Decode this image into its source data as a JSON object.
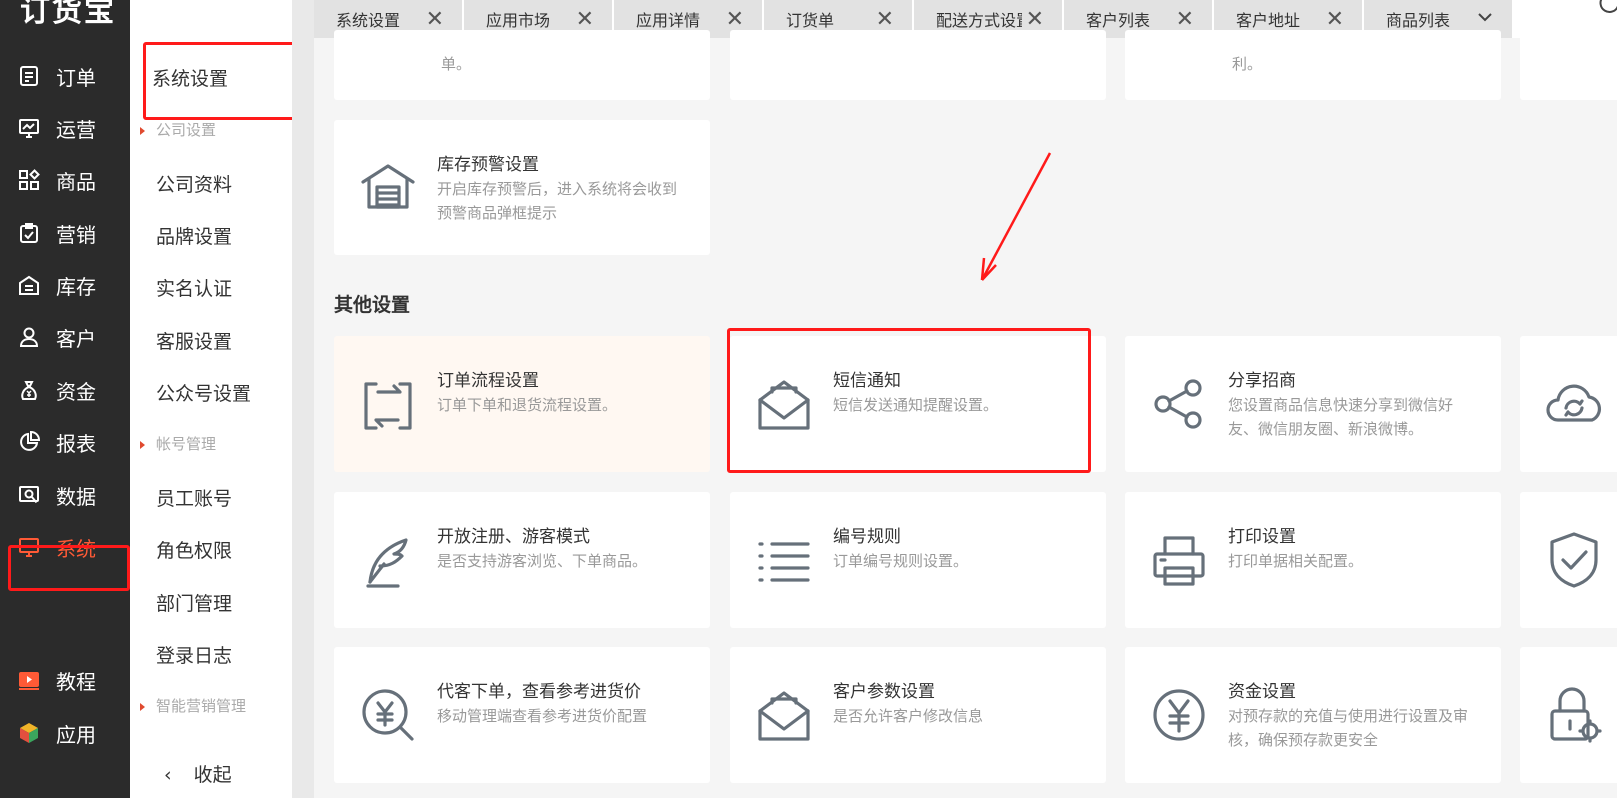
{
  "app": {
    "logo": "订货宝"
  },
  "nav": [
    {
      "label": "订单",
      "icon": "order-icon"
    },
    {
      "label": "运营",
      "icon": "operation-icon"
    },
    {
      "label": "商品",
      "icon": "goods-icon"
    },
    {
      "label": "营销",
      "icon": "marketing-icon"
    },
    {
      "label": "库存",
      "icon": "warehouse-icon"
    },
    {
      "label": "客户",
      "icon": "user-icon"
    },
    {
      "label": "资金",
      "icon": "money-bag-icon"
    },
    {
      "label": "报表",
      "icon": "pie-chart-icon"
    },
    {
      "label": "数据",
      "icon": "data-icon"
    },
    {
      "label": "系统",
      "icon": "monitor-icon",
      "active": true
    },
    {
      "label": "教程",
      "icon": "video-icon"
    },
    {
      "label": "应用",
      "icon": "cube-icon"
    }
  ],
  "submenu": {
    "title": "系统设置",
    "group1": "公司设置",
    "items1": [
      "公司资料",
      "品牌设置",
      "实名认证",
      "客服设置",
      "公众号设置"
    ],
    "group2": "帐号管理",
    "items2": [
      "员工账号",
      "角色权限",
      "部门管理",
      "登录日志"
    ],
    "group3": "智能营销管理",
    "collapse": "收起"
  },
  "tabs": [
    {
      "label": "系统设置",
      "closable": true
    },
    {
      "label": "应用市场",
      "closable": true
    },
    {
      "label": "应用详情",
      "closable": true
    },
    {
      "label": "订货单",
      "closable": true
    },
    {
      "label": "配送方式设置",
      "closable": true
    },
    {
      "label": "客户列表",
      "closable": true
    },
    {
      "label": "客户地址",
      "closable": true
    },
    {
      "label": "商品列表",
      "closable": false
    }
  ],
  "top_cards_partial": {
    "left_desc": "单。",
    "right_desc": "利。"
  },
  "stock_card": {
    "title": "库存预警设置",
    "desc": "开启库存预警后，进入系统将会收到预警商品弹框提示",
    "icon": "warehouse-icon"
  },
  "other_section": {
    "title": "其他设置"
  },
  "cards": [
    {
      "title": "订单流程设置",
      "desc": "订单下单和退货流程设置。",
      "icon": "flow-icon"
    },
    {
      "title": "短信通知",
      "desc": "短信发送通知提醒设置。",
      "icon": "envelope-icon"
    },
    {
      "title": "分享招商",
      "desc": "您设置商品信息快速分享到微信好友、微信朋友圈、新浪微博。",
      "icon": "share-icon"
    },
    {
      "title": "开放注册、游客模式",
      "desc": "是否支持游客浏览、下单商品。",
      "icon": "feather-icon"
    },
    {
      "title": "编号规则",
      "desc": "订单编号规则设置。",
      "icon": "list-icon"
    },
    {
      "title": "打印设置",
      "desc": "打印单据相关配置。",
      "icon": "printer-icon"
    },
    {
      "title": "代客下单，查看参考进货价",
      "desc": "移动管理端查看参考进货价配置",
      "icon": "yen-search-icon"
    },
    {
      "title": "客户参数设置",
      "desc": "是否允许客户修改信息",
      "icon": "envelope-icon"
    },
    {
      "title": "资金设置",
      "desc": "对预存款的充值与使用进行设置及审核，确保预存款更安全",
      "icon": "yen-circle-icon"
    }
  ],
  "edge_icons": [
    "cloud-sync-icon",
    "shield-check-icon",
    "lock-gear-icon"
  ],
  "colors": {
    "accent": "#ff5a36",
    "highlight_border": "#ff1a1a",
    "sidebar_bg": "#2b2b2b"
  }
}
